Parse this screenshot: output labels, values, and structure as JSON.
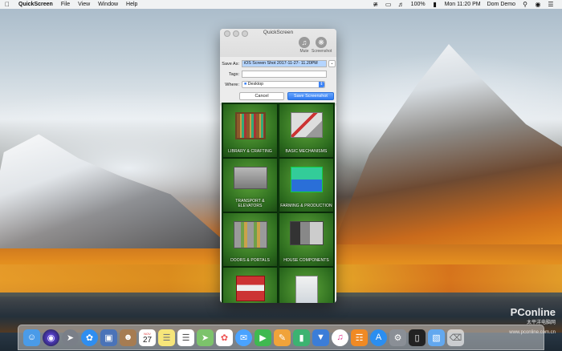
{
  "menubar": {
    "apple_icon": "apple-icon",
    "app_name": "QuickScreen",
    "items": [
      "File",
      "View",
      "Window",
      "Help"
    ],
    "battery": "100%",
    "clock": "Mon 11:20 PM",
    "user": "Dom Demo"
  },
  "window": {
    "title": "QuickScreen",
    "tools": [
      {
        "label": "Mute",
        "icon": "headphones-icon"
      },
      {
        "label": "Screenshot",
        "icon": "aperture-icon"
      }
    ],
    "save_sheet": {
      "save_as_label": "Save As:",
      "save_as_value": "iOS Screen Shot 2017-11-27- 11.20PM",
      "tags_label": "Tags:",
      "tags_value": "",
      "where_label": "Where:",
      "where_value": "Desktop",
      "cancel_label": "Cancel",
      "save_label": "Save Screenshot"
    }
  },
  "app_content": {
    "tiles": [
      {
        "label": "LIBRARY & CRAFTING"
      },
      {
        "label": "BASIC MECHANISMS"
      },
      {
        "label": "TRANSPORT & ELEVATORS"
      },
      {
        "label": "FARMING & PRODUCTION"
      },
      {
        "label": "DOORS & PORTALS"
      },
      {
        "label": "HOUSE COMPONENTS"
      },
      {
        "label": ""
      },
      {
        "label": ""
      }
    ]
  },
  "dock": {
    "apps": [
      "finder-icon",
      "siri-icon",
      "launchpad-icon",
      "safari-icon",
      "photo-viewer-icon",
      "contacts-icon",
      "calendar-icon",
      "notes-icon",
      "reminders-icon",
      "maps-icon",
      "photos-icon",
      "messages-icon",
      "facetime-icon",
      "pages-icon",
      "numbers-icon",
      "keynote-icon",
      "itunes-icon",
      "ibooks-icon",
      "app-store-icon",
      "system-preferences-icon",
      "iphone-icon",
      "folder-icon",
      "trash-icon"
    ],
    "calendar_day": "27",
    "calendar_month": "NOV"
  },
  "watermark": {
    "brand": "PConline",
    "tagline": "太平洋电脑网",
    "site": "www.pconline.com.cn"
  }
}
